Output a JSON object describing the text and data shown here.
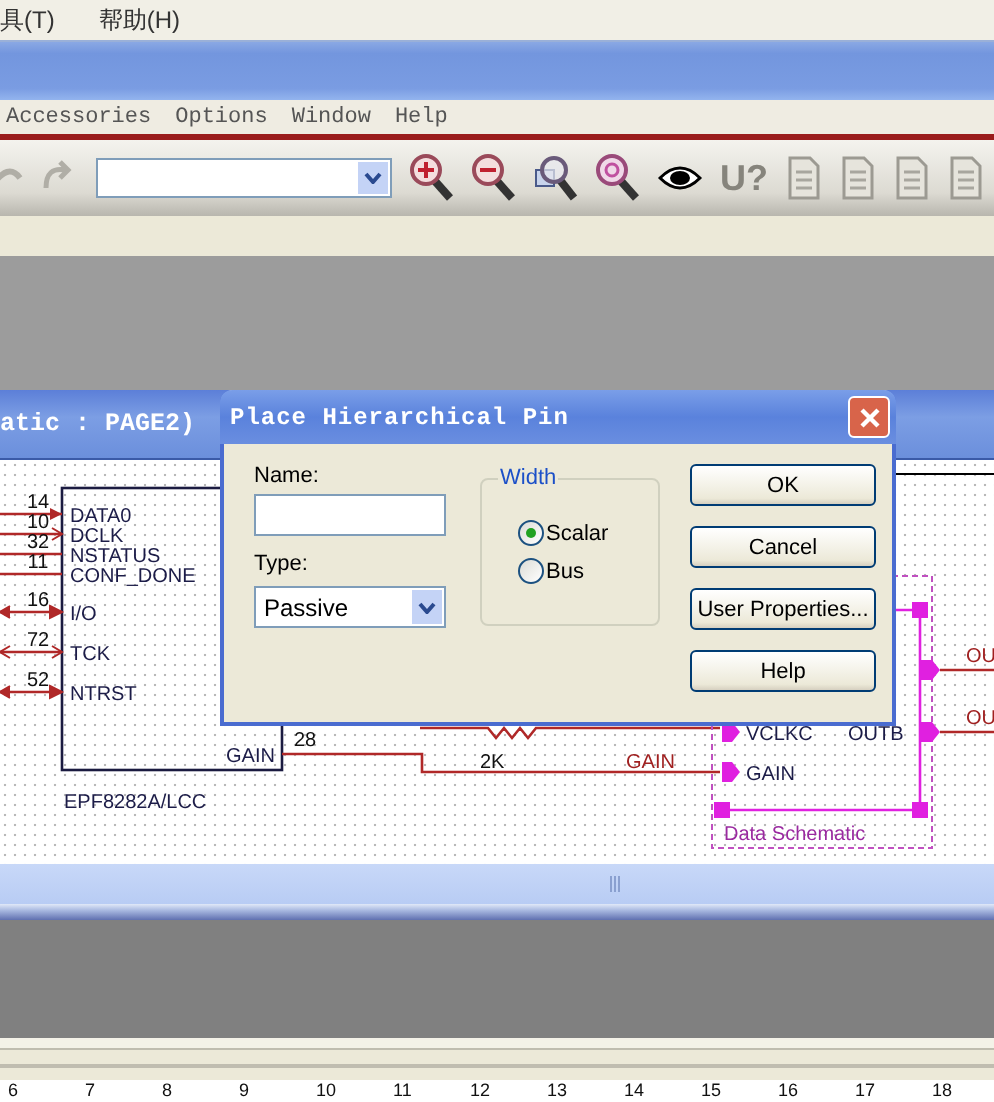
{
  "menubar": {
    "items": [
      "具(T)",
      "帮助(H)"
    ]
  },
  "menu": {
    "items": [
      "Accessories",
      "Options",
      "Window",
      "Help"
    ]
  },
  "toolbar": {
    "glyph_buttons": [
      "U?"
    ]
  },
  "schematic_window": {
    "title": "atic : PAGE2)"
  },
  "schematic": {
    "part": {
      "name": "EPF8282A/LCC",
      "pins": [
        {
          "number": "14",
          "name": "DATA0",
          "kind": "input"
        },
        {
          "number": "10",
          "name": "DCLK",
          "kind": "clock"
        },
        {
          "number": "32",
          "name": "NSTATUS",
          "kind": "plain"
        },
        {
          "number": "11",
          "name": "CONF_DONE",
          "kind": "plain"
        },
        {
          "number": "16",
          "name": "I/O",
          "kind": "bidir"
        },
        {
          "number": "72",
          "name": "TCK",
          "kind": "clockbidir"
        },
        {
          "number": "52",
          "name": "NTRST",
          "kind": "bidir"
        }
      ],
      "output_pin": {
        "number": "28",
        "name": "GAIN"
      }
    },
    "resistor_value": "2K",
    "net_label": "GAIN",
    "block": {
      "name": "Data Schematic",
      "pins": [
        {
          "name": "VCLKC",
          "kind": "input"
        },
        {
          "name": "GAIN",
          "kind": "input"
        },
        {
          "name": "OUTB",
          "kind": "output"
        }
      ]
    },
    "offpage_labels": [
      "OU",
      "OU"
    ]
  },
  "dialog": {
    "title": "Place Hierarchical Pin",
    "name_label": "Name:",
    "type_label": "Type:",
    "type_value": "Passive",
    "width_group": "Width",
    "width_options": [
      {
        "label": "Scalar",
        "selected": true
      },
      {
        "label": "Bus",
        "selected": false
      }
    ],
    "buttons": [
      "OK",
      "Cancel",
      "User Properties...",
      "Help"
    ]
  },
  "ruler": {
    "labels": [
      "6",
      "7",
      "8",
      "9",
      "10",
      "11",
      "12",
      "13",
      "14",
      "15",
      "16",
      "17",
      "18"
    ]
  }
}
